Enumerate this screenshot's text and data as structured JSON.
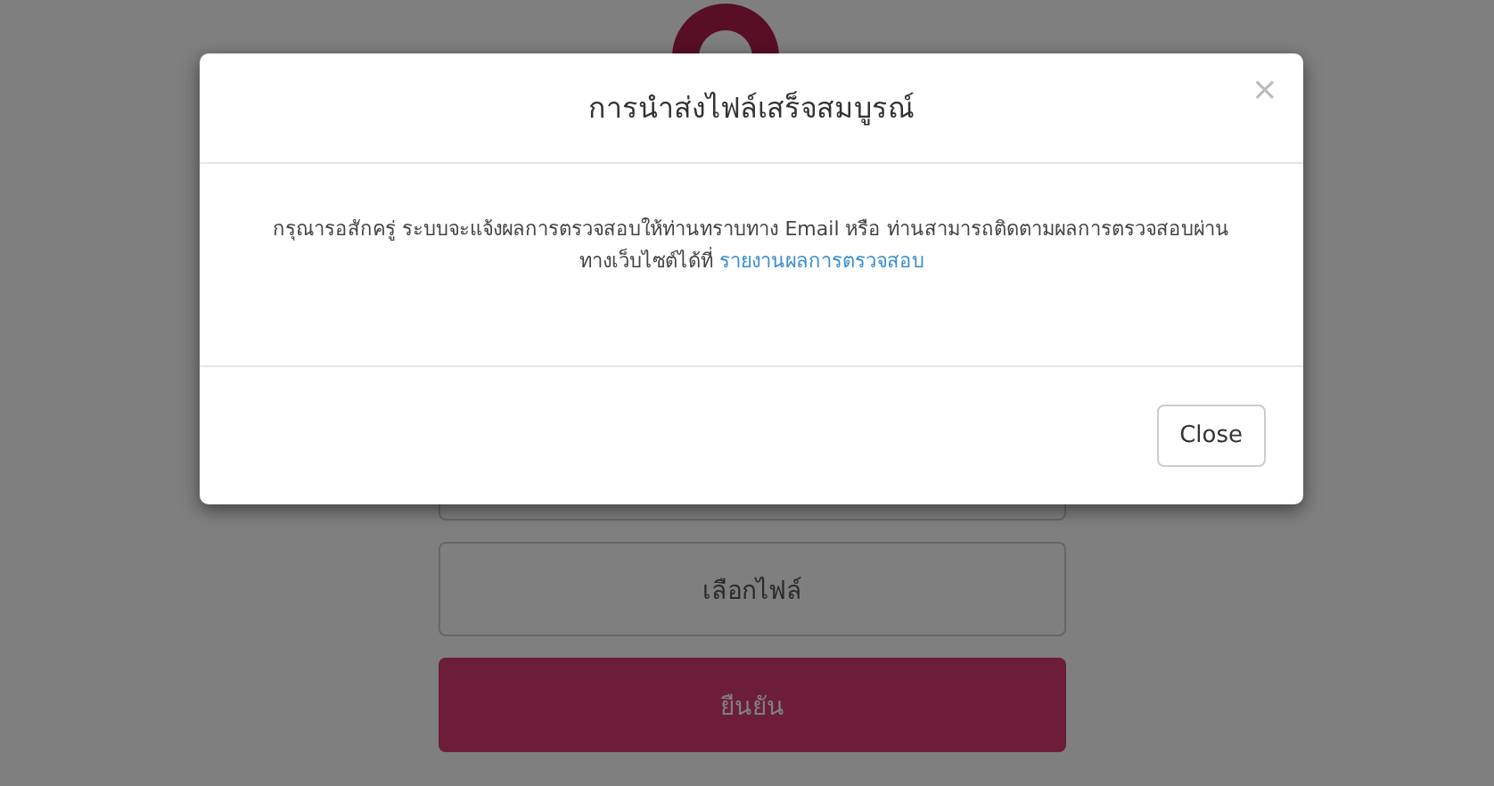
{
  "background_form": {
    "file_button": "เลือกไฟล์",
    "confirm_button": "ยืนยัน"
  },
  "modal": {
    "title": "การนำส่งไฟล์เสร็จสมบูรณ์",
    "close_icon": "×",
    "message": "กรุณารอสักครู่ ระบบจะแจ้งผลการตรวจสอบให้ท่านทราบทาง Email หรือ ท่านสามารถติดตามผลการตรวจสอบผ่านทางเว็บไซต์ได้ที่",
    "link": "รายงานผลการตรวจสอบ",
    "close_button": "Close"
  }
}
